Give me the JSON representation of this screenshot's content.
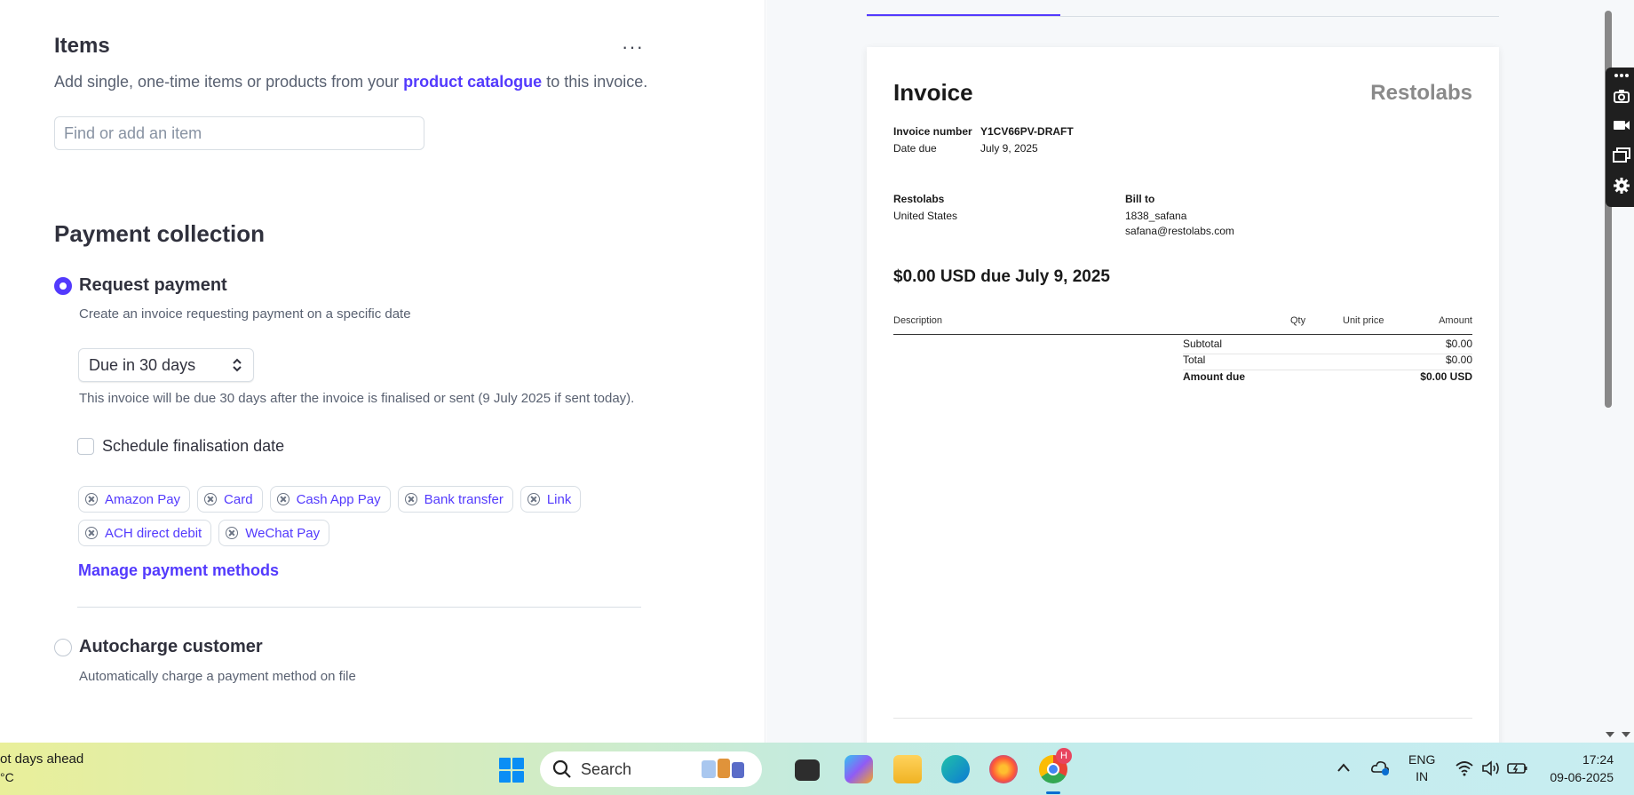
{
  "items": {
    "title": "Items",
    "more_label": "···",
    "description_prefix": "Add single, one-time items or products from your ",
    "description_link": "product catalogue",
    "description_suffix": " to this invoice.",
    "search_placeholder": "Find or add an item"
  },
  "payment": {
    "title": "Payment collection",
    "request": {
      "label": "Request payment",
      "sub": "Create an invoice requesting payment on a specific date",
      "selected": true
    },
    "due_select": "Due in 30 days",
    "due_note": "This invoice will be due 30 days after the invoice is finalised or sent (9 July 2025 if sent today).",
    "schedule_label": "Schedule finalisation date",
    "methods": [
      "Amazon Pay",
      "Card",
      "Cash App Pay",
      "Bank transfer",
      "Link",
      "ACH direct debit",
      "WeChat Pay"
    ],
    "manage_link": "Manage payment methods",
    "autocharge": {
      "label": "Autocharge customer",
      "sub": "Automatically charge a payment method on file",
      "selected": false
    }
  },
  "invoice": {
    "title": "Invoice",
    "brand": "Restolabs",
    "number_label": "Invoice number",
    "number": "Y1CV66PV-DRAFT",
    "date_label": "Date due",
    "date": "July 9, 2025",
    "from_name": "Restolabs",
    "from_country": "United States",
    "bill_to_label": "Bill to",
    "bill_to_name": "1838_safana",
    "bill_to_email": "safana@restolabs.com",
    "amount_due_heading": "$0.00 USD due July 9, 2025",
    "col_description": "Description",
    "col_qty": "Qty",
    "col_unit_price": "Unit price",
    "col_amount": "Amount",
    "subtotal_label": "Subtotal",
    "subtotal": "$0.00",
    "total_label": "Total",
    "total": "$0.00",
    "amount_due_label": "Amount due",
    "amount_due": "$0.00 USD"
  },
  "taskbar": {
    "weather_line1": "ot days ahead",
    "weather_line2": "°C",
    "search_label": "Search",
    "lang_1": "ENG",
    "lang_2": "IN",
    "time": "17:24",
    "date": "09-06-2025",
    "chrome_badge": "H"
  },
  "colors": {
    "accent": "#533afd",
    "text": "#30313d",
    "muted": "#596171"
  }
}
